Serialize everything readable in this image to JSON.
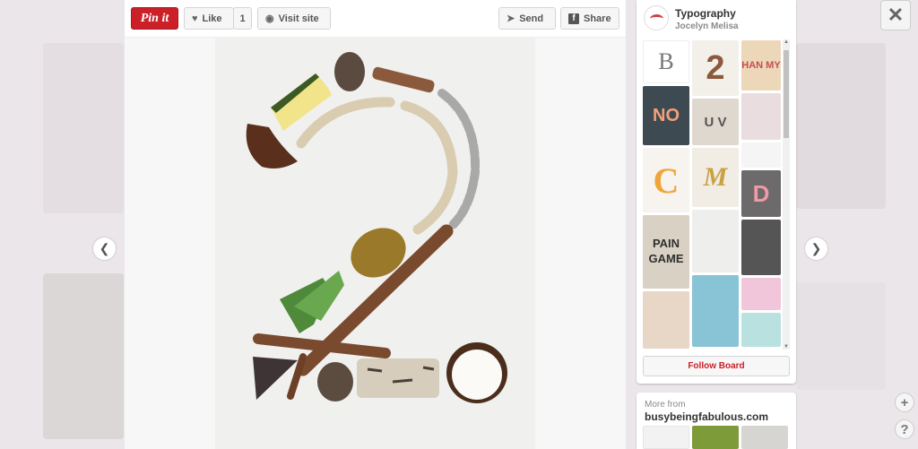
{
  "toolbar": {
    "pin_it_label": "Pin it",
    "like_label": "Like",
    "like_count": "1",
    "visit_label": "Visit site",
    "send_label": "Send",
    "share_label": "Share"
  },
  "board": {
    "title": "Typography",
    "owner": "Jocelyn Melisa",
    "thumb_labels": [
      "B",
      "2",
      "HAN MY",
      "NO",
      "U V",
      "C",
      "M",
      "D",
      "PAIN GAME"
    ],
    "follow_label": "Follow Board"
  },
  "more_from": {
    "label": "More from",
    "site": "busybeingfabulous.com"
  },
  "icons": {
    "close": "close-icon",
    "prev": "chevron-left-icon",
    "next": "chevron-right-icon",
    "add": "plus-icon",
    "help": "question-icon"
  },
  "colors": {
    "brand_red": "#cb2027",
    "overlay": "#e7e3e7"
  }
}
